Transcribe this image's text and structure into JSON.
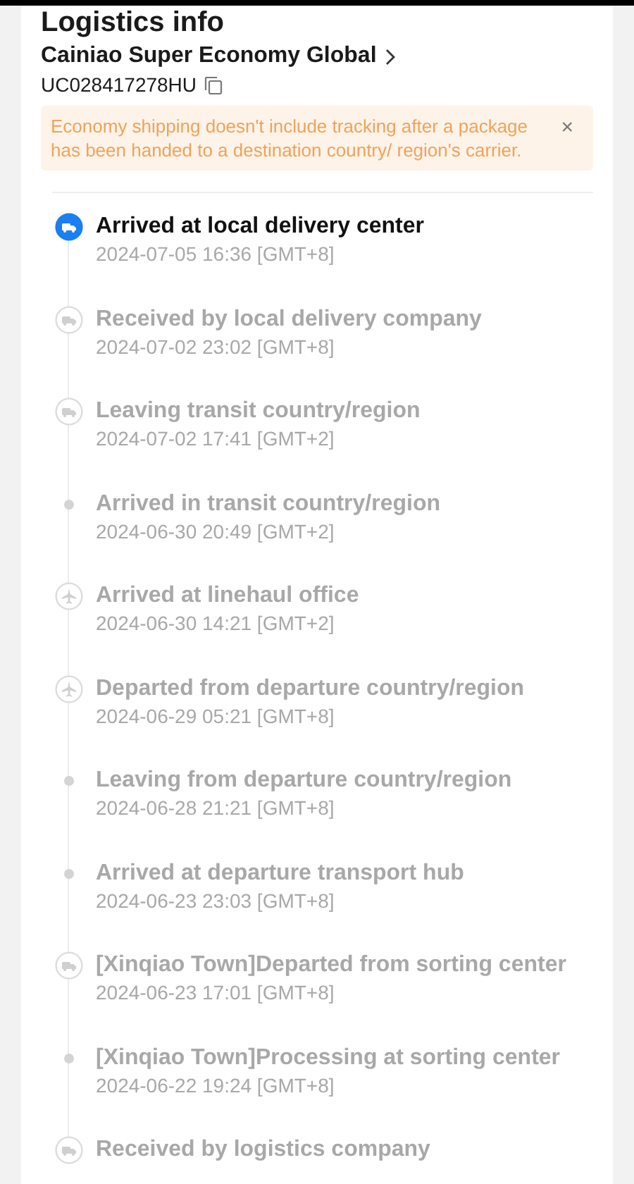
{
  "title": "Logistics info",
  "carrier": "Cainiao Super Economy Global",
  "tracking_number": "UC028417278HU",
  "notice": {
    "text": "Economy shipping doesn't include tracking after a package has been handed to a destination country/ region's carrier.",
    "close": "×"
  },
  "events": [
    {
      "kind": "truck",
      "selected": true,
      "title": "Arrived at local delivery center",
      "time": "2024-07-05 16:36 [GMT+8]"
    },
    {
      "kind": "truck",
      "selected": false,
      "title": "Received by local delivery company",
      "time": "2024-07-02 23:02 [GMT+8]"
    },
    {
      "kind": "truck",
      "selected": false,
      "title": "Leaving transit country/region",
      "time": "2024-07-02 17:41 [GMT+2]"
    },
    {
      "kind": "dot",
      "selected": false,
      "title": "Arrived in transit country/region",
      "time": "2024-06-30 20:49 [GMT+2]"
    },
    {
      "kind": "plane",
      "selected": false,
      "title": "Arrived at linehaul office",
      "time": "2024-06-30 14:21 [GMT+2]"
    },
    {
      "kind": "plane",
      "selected": false,
      "title": "Departed from departure country/region",
      "time": "2024-06-29 05:21 [GMT+8]"
    },
    {
      "kind": "dot",
      "selected": false,
      "title": "Leaving from departure country/region",
      "time": "2024-06-28 21:21 [GMT+8]"
    },
    {
      "kind": "dot",
      "selected": false,
      "title": "Arrived at departure transport hub",
      "time": "2024-06-23 23:03 [GMT+8]"
    },
    {
      "kind": "truck",
      "selected": false,
      "title": "[Xinqiao Town]Departed from sorting center",
      "time": "2024-06-23 17:01 [GMT+8]"
    },
    {
      "kind": "dot",
      "selected": false,
      "title": "[Xinqiao Town]Processing at sorting center",
      "time": "2024-06-22 19:24 [GMT+8]"
    },
    {
      "kind": "truck",
      "selected": false,
      "title": "Received by logistics company"
    }
  ]
}
